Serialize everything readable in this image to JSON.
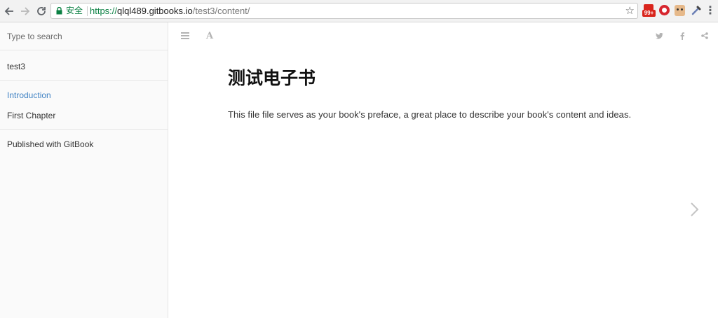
{
  "browser": {
    "back_icon": "arrow-left-icon",
    "forward_icon": "arrow-right-icon",
    "reload_icon": "reload-icon",
    "secure_label": "安全",
    "url": {
      "scheme": "https://",
      "host": "qlql489.gitbooks.io",
      "path": "/test3/content/"
    },
    "bookmark_icon": "star-icon",
    "extension_badge": "99+",
    "extensions": [
      "mail-extension-icon",
      "opera-extension-icon",
      "face-extension-icon",
      "eyedropper-extension-icon"
    ],
    "menu_icon": "more-vert-icon"
  },
  "sidebar": {
    "search_placeholder": "Type to search",
    "book_title": "test3",
    "chapters": [
      {
        "label": "Introduction",
        "active": true
      },
      {
        "label": "First Chapter",
        "active": false
      }
    ],
    "footer_link": "Published with GitBook"
  },
  "main": {
    "header_left_icons": [
      "hamburger-icon",
      "font-settings-icon"
    ],
    "header_right_icons": [
      "twitter-icon",
      "facebook-icon",
      "share-icon"
    ],
    "title": "测试电子书",
    "body": "This file file serves as your book's preface, a great place to describe your book's content and ideas.",
    "next_icon": "chevron-right-icon"
  },
  "colors": {
    "accent": "#4183c4",
    "secure_green": "#0b8043",
    "badge_red": "#d9251c"
  }
}
